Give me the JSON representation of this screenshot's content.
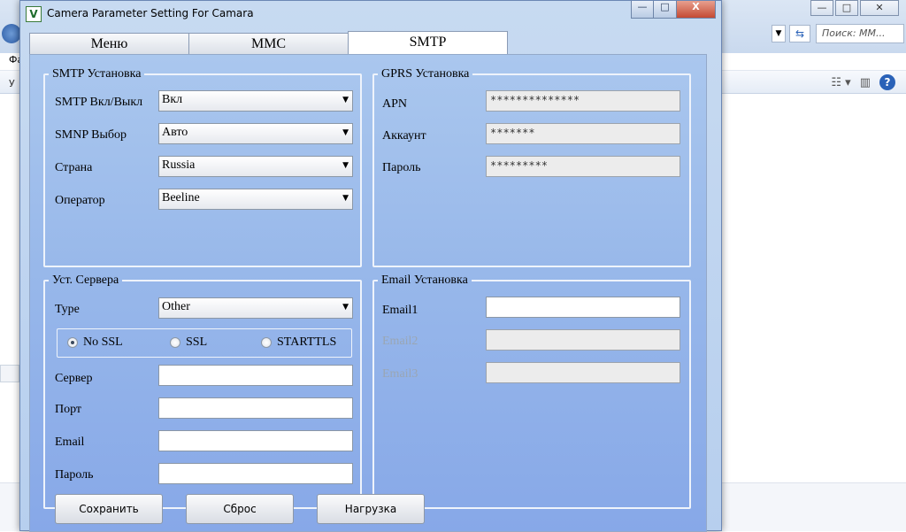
{
  "window": {
    "title": "Camera Parameter Setting For  Camara",
    "controls": {
      "minimize": "—",
      "maximize": "□",
      "close": "X"
    }
  },
  "tabs": [
    {
      "label": "Меню",
      "active": false
    },
    {
      "label": "MMC",
      "active": false
    },
    {
      "label": "SMTP",
      "active": true
    }
  ],
  "smtp_group": {
    "legend": "SMTP Установка",
    "rows": [
      {
        "label": "SMTP Вкл/Выкл",
        "value": "Вкл"
      },
      {
        "label": "SMNP Выбор",
        "value": "Авто"
      },
      {
        "label": "Страна",
        "value": "Russia"
      },
      {
        "label": "Оператор",
        "value": "Beeline"
      }
    ]
  },
  "gprs_group": {
    "legend": "GPRS Установка",
    "rows": [
      {
        "label": "APN",
        "value": "**************"
      },
      {
        "label": "Аккаунт",
        "value": "*******"
      },
      {
        "label": "Пароль",
        "value": "*********"
      }
    ]
  },
  "server_group": {
    "legend": "Уст. Сервера",
    "type_label": "Type",
    "type_value": "Other",
    "ssl_options": [
      {
        "label": "No SSL",
        "selected": true
      },
      {
        "label": "SSL",
        "selected": false
      },
      {
        "label": "STARTTLS",
        "selected": false
      }
    ],
    "fields": [
      {
        "label": "Сервер",
        "value": ""
      },
      {
        "label": "Порт",
        "value": ""
      },
      {
        "label": "Email",
        "value": ""
      },
      {
        "label": "Пароль",
        "value": ""
      }
    ]
  },
  "email_group": {
    "legend": "Email Установка",
    "rows": [
      {
        "label": "Email1",
        "value": "",
        "enabled": true
      },
      {
        "label": "Email2",
        "value": "",
        "enabled": false
      },
      {
        "label": "Email3",
        "value": "",
        "enabled": false
      }
    ]
  },
  "buttons": {
    "save": "Сохранить",
    "reset": "Сброс",
    "load": "Нагрузка"
  },
  "background_window": {
    "search_placeholder": "Поиск: MM...",
    "menu_fragment": "Фа",
    "left_fragment": "У"
  }
}
